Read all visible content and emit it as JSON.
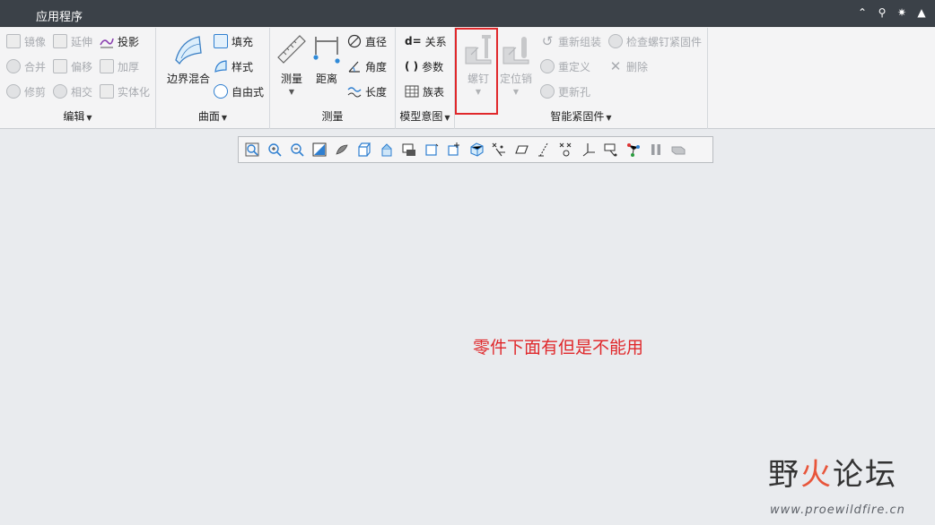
{
  "app": {
    "title": "应用程序"
  },
  "title_icons": [
    "chevron-up-icon",
    "search-icon",
    "settings-icon",
    "graduation-cap-icon"
  ],
  "ribbon": {
    "edit": {
      "label": "编辑",
      "items": [
        {
          "label": "镜像",
          "disabled": true
        },
        {
          "label": "延伸",
          "disabled": true
        },
        {
          "label": "投影",
          "disabled": false
        },
        {
          "label": "合并",
          "disabled": true
        },
        {
          "label": "偏移",
          "disabled": true
        },
        {
          "label": "加厚",
          "disabled": true
        },
        {
          "label": "修剪",
          "disabled": true
        },
        {
          "label": "相交",
          "disabled": true
        },
        {
          "label": "实体化",
          "disabled": true
        }
      ]
    },
    "surface": {
      "label": "曲面",
      "boundary_blend": "边界混合",
      "items": [
        {
          "label": "填充"
        },
        {
          "label": "样式"
        },
        {
          "label": "自由式"
        }
      ]
    },
    "measure": {
      "label": "测量",
      "measure": "测量",
      "distance": "距离",
      "items": [
        {
          "label": "直径"
        },
        {
          "label": "角度"
        },
        {
          "label": "长度"
        }
      ]
    },
    "model_intent": {
      "label": "模型意图",
      "items": [
        {
          "label": "关系",
          "prefix": "d="
        },
        {
          "label": "参数",
          "prefix": "( )"
        },
        {
          "label": "族表"
        }
      ]
    },
    "smart_fastener": {
      "label": "智能紧固件",
      "screw": "螺钉",
      "dowel": "定位销",
      "items": [
        {
          "label": "重新组装"
        },
        {
          "label": "检查螺钉紧固件"
        },
        {
          "label": "重定义"
        },
        {
          "label": "删除"
        },
        {
          "label": "更新孔"
        }
      ]
    }
  },
  "view_toolbar": {
    "icons": [
      "zoom-fit-icon",
      "zoom-in-icon",
      "zoom-out-icon",
      "reorient-icon",
      "display-style-icon",
      "saved-views-icon",
      "view-manager-icon",
      "perspective-icon",
      "annotation-display-icon",
      "spin-center-icon",
      "section-icon",
      "datum-display-icon",
      "plane-display-icon",
      "axis-display-icon",
      "point-display-icon",
      "csys-display-icon",
      "annotation-icon",
      "connectivity-icon",
      "pause-icon",
      "layer-icon"
    ]
  },
  "annotation": {
    "text": "零件下面有但是不能用"
  },
  "watermark": {
    "title_black_1": "野",
    "title_red": "火",
    "title_black_2": "论坛",
    "url": "www.proewildfire.cn"
  }
}
